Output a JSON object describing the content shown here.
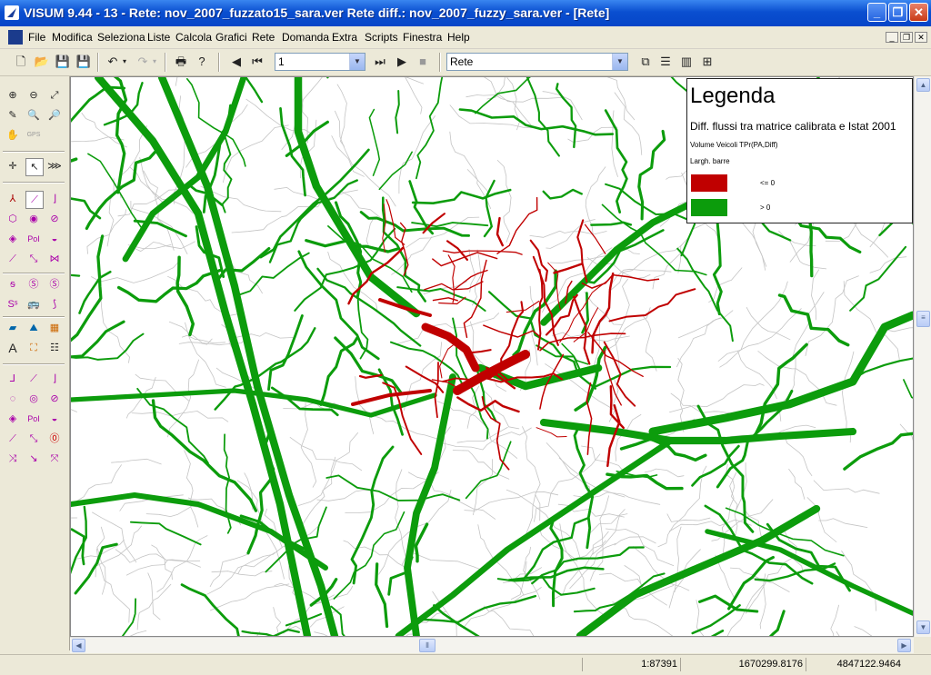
{
  "window": {
    "title": "VISUM 9.44 - 13 - Rete: nov_2007_fuzzato15_sara.ver Rete diff.: nov_2007_fuzzy_sara.ver - [Rete]",
    "minimize": "_",
    "maximize": "❐",
    "close": "✕"
  },
  "menu": {
    "items": [
      "File",
      "Modifica",
      "Seleziona",
      "Liste",
      "Calcola",
      "Grafici",
      "Rete",
      "Domanda",
      "Extra",
      "Scripts",
      "Finestra",
      "Help"
    ]
  },
  "toolbar": {
    "page_value": "1",
    "view_value": "Rete"
  },
  "legend": {
    "title": "Legenda",
    "subtitle": "Diff. flussi tra matrice calibrata e Istat 2001",
    "attribute": "Volume Veicoli TPr(PA,Diff)",
    "bar_label": "Largh. barre",
    "entries": [
      {
        "label": "<= 0",
        "color": "#c00000"
      },
      {
        "label": "> 0",
        "color": "#0c9c0c"
      }
    ]
  },
  "colors": {
    "negative": "#c00000",
    "positive": "#0c9c0c",
    "network": "#c4c4c4",
    "titlebar": "#0a4fd0"
  },
  "status": {
    "scale": "1:87391",
    "x_coord": "1670299.8176",
    "y_coord": "4847122.9464"
  }
}
